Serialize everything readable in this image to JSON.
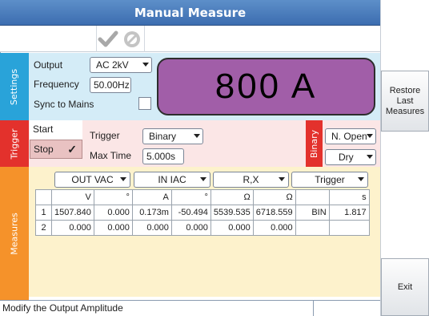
{
  "title": "Manual Measure",
  "toolbar": {
    "check_icon": "checkmark-icon",
    "cancel_icon": "cancel-icon"
  },
  "sections": {
    "settings": "Settings",
    "trigger": "Trigger",
    "measures": "Measures",
    "binary": "Binary"
  },
  "settings": {
    "output_label": "Output",
    "output_value": "AC 2kV",
    "frequency_label": "Frequency",
    "frequency_value": "50.00Hz",
    "sync_label": "Sync to Mains",
    "display_value": "800 A"
  },
  "trigger": {
    "start_label": "Start",
    "stop_label": "Stop",
    "stop_check": "✓",
    "trigger_label": "Trigger",
    "trigger_value": "Binary",
    "maxtime_label": "Max Time",
    "maxtime_value": "5.000s",
    "binary_mode": "N. Open",
    "binary_type": "Dry"
  },
  "measures": {
    "column_selectors": [
      "OUT VAC",
      "IN IAC",
      "R,X",
      "Trigger"
    ],
    "units": [
      "",
      "V",
      "°",
      "A",
      "°",
      "Ω",
      "Ω",
      "",
      "s"
    ],
    "rows": [
      [
        "1",
        "1507.840",
        "0.000",
        "0.173m",
        "-50.494",
        "5539.535",
        "6718.559",
        "BIN",
        "1.817"
      ],
      [
        "2",
        "0.000",
        "0.000",
        "0.000",
        "0.000",
        "0.000",
        "0.000",
        "",
        ""
      ]
    ]
  },
  "right_buttons": {
    "restore": "Restore Last Measures",
    "exit": "Exit"
  },
  "status_text": "Modify the Output Amplitude",
  "colors": {
    "title_bar": "#4a7cbf",
    "settings_strip": "#29a3d9",
    "trigger_strip": "#e3312c",
    "measures_strip": "#f5922a",
    "display_bg": "#a15ea8"
  }
}
